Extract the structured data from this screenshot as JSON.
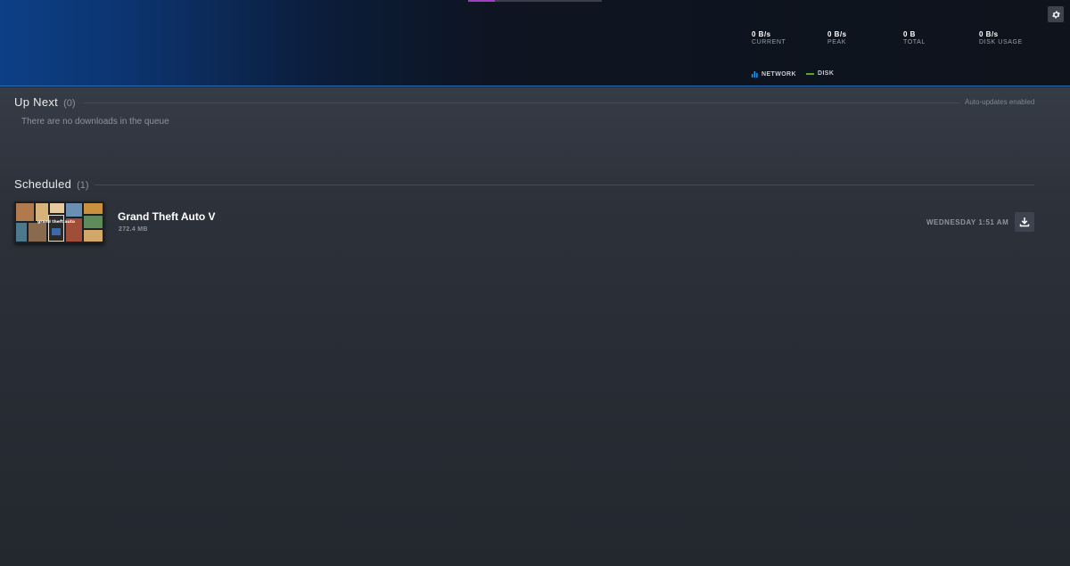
{
  "stats": [
    {
      "value": "0 B/s",
      "label": "CURRENT"
    },
    {
      "value": "0 B/s",
      "label": "PEAK"
    },
    {
      "value": "0 B",
      "label": "TOTAL"
    },
    {
      "value": "0 B/s",
      "label": "DISK USAGE"
    }
  ],
  "legend": {
    "network": {
      "label": "NETWORK",
      "color": "#1a9fff"
    },
    "disk": {
      "label": "DISK",
      "color": "#5ba32b"
    }
  },
  "icons": {
    "settings": "gear-icon",
    "download": "download-icon",
    "network": "bar-chart-icon"
  },
  "up_next": {
    "title": "Up Next",
    "count": "(0)",
    "auto_updates": "Auto-updates enabled",
    "empty_message": "There are no downloads in the queue"
  },
  "scheduled": {
    "title": "Scheduled",
    "count": "(1)",
    "items": [
      {
        "name": "Grand Theft Auto V",
        "size": "272.4 MB",
        "time": "WEDNESDAY 1:51 AM",
        "logo_text": "grand theft auto"
      }
    ]
  }
}
